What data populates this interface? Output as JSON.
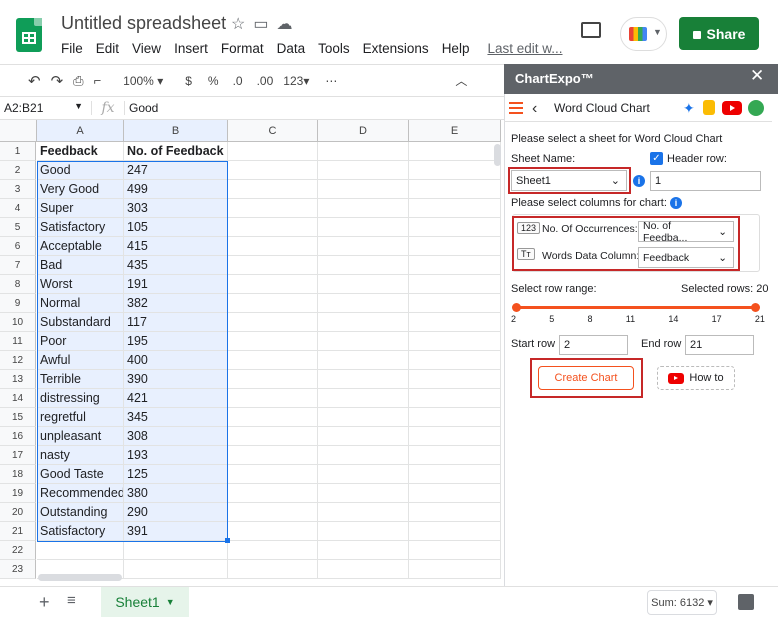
{
  "app": {
    "doc_title": "Untitled spreadsheet",
    "menu": [
      "File",
      "Edit",
      "View",
      "Insert",
      "Format",
      "Data",
      "Tools",
      "Extensions",
      "Help"
    ],
    "last_edit": "Last edit w...",
    "share_label": "Share"
  },
  "toolbar": {
    "zoom": "100%",
    "currency": "$",
    "percent": "%",
    "dec_decrease": ".0",
    "dec_increase": ".00",
    "number_format": "123"
  },
  "formula_bar": {
    "name_box": "A2:B21",
    "fx": "fx",
    "value": "Good"
  },
  "grid": {
    "columns": [
      "A",
      "B",
      "C",
      "D",
      "E"
    ],
    "rows": [
      {
        "n": "1",
        "a": "Feedback",
        "b": "No. of Feedback"
      },
      {
        "n": "2",
        "a": "Good",
        "b": "247"
      },
      {
        "n": "3",
        "a": "Very Good",
        "b": "499"
      },
      {
        "n": "4",
        "a": "Super",
        "b": "303"
      },
      {
        "n": "5",
        "a": "Satisfactory",
        "b": "105"
      },
      {
        "n": "6",
        "a": "Acceptable",
        "b": "415"
      },
      {
        "n": "7",
        "a": "Bad",
        "b": "435"
      },
      {
        "n": "8",
        "a": "Worst",
        "b": "191"
      },
      {
        "n": "9",
        "a": "Normal",
        "b": "382"
      },
      {
        "n": "10",
        "a": "Substandard",
        "b": "117"
      },
      {
        "n": "11",
        "a": "Poor",
        "b": "195"
      },
      {
        "n": "12",
        "a": "Awful",
        "b": "400"
      },
      {
        "n": "13",
        "a": "Terrible",
        "b": "390"
      },
      {
        "n": "14",
        "a": "distressing",
        "b": "421"
      },
      {
        "n": "15",
        "a": "regretful",
        "b": "345"
      },
      {
        "n": "16",
        "a": "unpleasant",
        "b": "308"
      },
      {
        "n": "17",
        "a": "nasty",
        "b": "193"
      },
      {
        "n": "18",
        "a": "Good Taste",
        "b": "125"
      },
      {
        "n": "19",
        "a": "Recommended",
        "b": "380"
      },
      {
        "n": "20",
        "a": "Outstanding",
        "b": "290"
      },
      {
        "n": "21",
        "a": "Satisfactory",
        "b": "391"
      },
      {
        "n": "22",
        "a": "",
        "b": ""
      },
      {
        "n": "23",
        "a": "",
        "b": ""
      }
    ]
  },
  "bottom": {
    "sheet_tab": "Sheet1",
    "sum": "Sum: 6132"
  },
  "panel": {
    "title": "ChartExpo™",
    "chart_name": "Word Cloud Chart",
    "instruction": "Please select a sheet for Word Cloud Chart",
    "sheet_name_label": "Sheet Name:",
    "sheet_value": "Sheet1",
    "header_row_label": "Header row:",
    "header_row_value": "1",
    "select_columns_label": "Please select columns for chart:",
    "occurrences_badge": "123",
    "occurrences_label": "No. Of Occurrences:",
    "occurrences_value": "No. of Feedba...",
    "words_badge": "Tт",
    "words_label": "Words Data Column:",
    "words_value": "Feedback",
    "row_range_label": "Select row range:",
    "selected_rows": "Selected rows: 20",
    "ticks": [
      "2",
      "5",
      "8",
      "11",
      "14",
      "17",
      "21"
    ],
    "start_row_label": "Start row",
    "start_row_value": "2",
    "end_row_label": "End row",
    "end_row_value": "21",
    "create_label": "Create Chart",
    "howto_label": "How to"
  }
}
